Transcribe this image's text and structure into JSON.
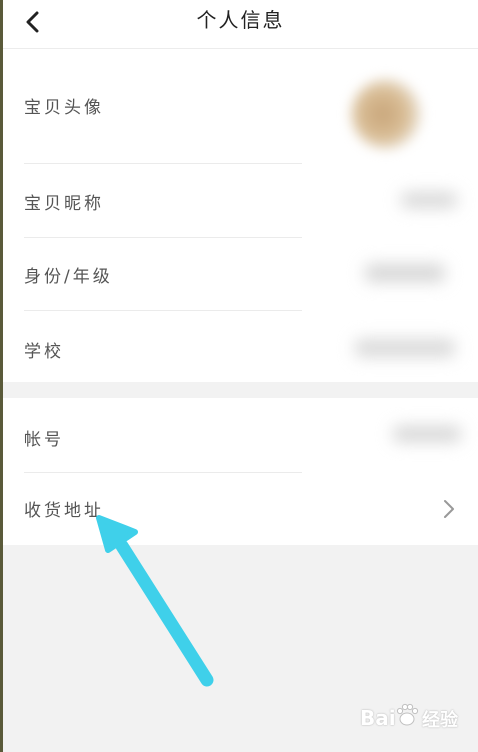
{
  "header": {
    "title": "个人信息",
    "back_icon": "chevron-left-icon"
  },
  "profile": {
    "avatar_label": "宝贝头像",
    "nickname_label": "宝贝昵称",
    "identity_label": "身份/年级",
    "school_label": "学校"
  },
  "account": {
    "account_label": "帐号",
    "address_label": "收货地址",
    "address_chevron_icon": "chevron-right-icon"
  },
  "annotation": {
    "arrow_color": "#3fd0ea"
  },
  "watermark": {
    "brand": "Bai",
    "suffix": "经验",
    "icon": "baidu-paw-icon"
  }
}
